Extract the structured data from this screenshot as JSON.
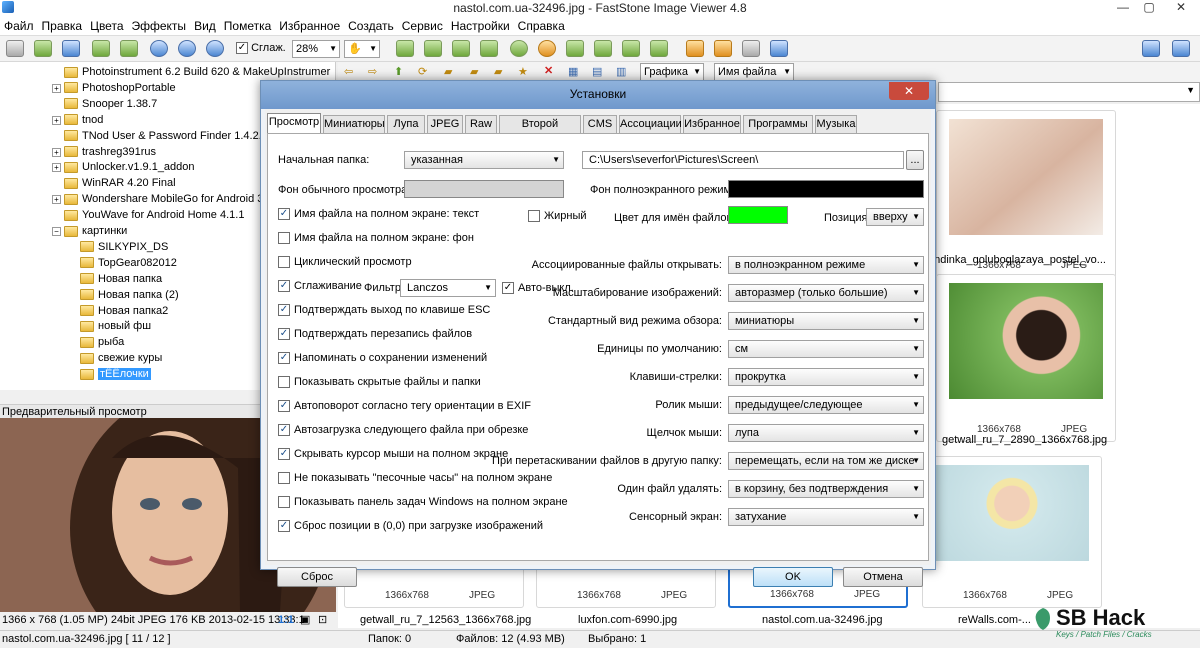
{
  "window": {
    "title": "nastol.com.ua-32496.jpg  -  FastStone Image Viewer 4.8"
  },
  "menu": [
    "Файл",
    "Правка",
    "Цвета",
    "Эффекты",
    "Вид",
    "Пометка",
    "Избранное",
    "Создать",
    "Сервис",
    "Настройки",
    "Справка"
  ],
  "toolbar": {
    "smooth_label": "Сглаж.",
    "zoom": "28%"
  },
  "tree": {
    "items": [
      {
        "label": "Photoinstrument 6.2 Build 620 & MakeUpInstrumer",
        "depth": 1,
        "exp": ""
      },
      {
        "label": "PhotoshopPortable",
        "depth": 1,
        "exp": "+"
      },
      {
        "label": "Snooper 1.38.7",
        "depth": 1,
        "exp": ""
      },
      {
        "label": "tnod",
        "depth": 1,
        "exp": "+"
      },
      {
        "label": "TNod User & Password Finder 1.4.2.1",
        "depth": 1,
        "exp": ""
      },
      {
        "label": "trashreg391rus",
        "depth": 1,
        "exp": "+"
      },
      {
        "label": "Unlocker.v1.9.1_addon",
        "depth": 1,
        "exp": "+"
      },
      {
        "label": "WinRAR 4.20 Final",
        "depth": 1,
        "exp": ""
      },
      {
        "label": "Wondershare MobileGo for Android 3",
        "depth": 1,
        "exp": "+"
      },
      {
        "label": "YouWave for Android Home 4.1.1",
        "depth": 1,
        "exp": ""
      },
      {
        "label": "картинки",
        "depth": 1,
        "exp": "-"
      },
      {
        "label": "SILKYPIX_DS",
        "depth": 2,
        "exp": ""
      },
      {
        "label": "TopGear082012",
        "depth": 2,
        "exp": ""
      },
      {
        "label": "Новая папка",
        "depth": 2,
        "exp": ""
      },
      {
        "label": "Новая папка (2)",
        "depth": 2,
        "exp": ""
      },
      {
        "label": "Новая папка2",
        "depth": 2,
        "exp": ""
      },
      {
        "label": "новый фш",
        "depth": 2,
        "exp": ""
      },
      {
        "label": "рыба",
        "depth": 2,
        "exp": ""
      },
      {
        "label": "свежие куры",
        "depth": 2,
        "exp": ""
      },
      {
        "label": "тЁЁлочки",
        "depth": 2,
        "exp": "",
        "selected": true
      }
    ]
  },
  "preview": {
    "label": "Предварительный просмотр",
    "info": "1366 x 768 (1.05 MP)  24bit  JPEG   176 KB   2013-02-15 13:33:1",
    "zoom": "1:1"
  },
  "thumbbar": {
    "sort_kind": "Графика",
    "sort_by": "Имя файла"
  },
  "thumbs": [
    {
      "dim": "1366x768",
      "fmt": "JPEG",
      "name": "endinka_goluboglazaya_postel_vo...",
      "color": "#e9d7c9"
    },
    {
      "dim": "1366x768",
      "fmt": "JPEG",
      "name": "getwall_ru_7_2890_1366x768.jpg",
      "color": "#6aa34d"
    },
    {
      "dim": "1366x768",
      "fmt": "JPEG",
      "name": "getwall_ru_7_12563_1366x768.jpg",
      "color": "#b4a493"
    },
    {
      "dim": "1366x768",
      "fmt": "JPEG",
      "name": "luxfon.com-6990.jpg",
      "color": "#c9ab95"
    },
    {
      "dim": "1366x768",
      "fmt": "JPEG",
      "name": "nastol.com.ua-32496.jpg",
      "color": "#a27460"
    },
    {
      "dim": "1366x768",
      "fmt": "JPEG",
      "name": "reWalls.com-...",
      "color": "#cfe6ea"
    }
  ],
  "statusbar": {
    "file": "nastol.com.ua-32496.jpg [ 11 / 12 ]",
    "folders": "Папок: 0",
    "files": "Файлов: 12 (4.93 MB)",
    "selected": "Выбрано: 1"
  },
  "dialog": {
    "title": "Установки",
    "close": "✕",
    "tabs": [
      "Просмотр",
      "Миниатюры",
      "Лупа",
      "JPEG",
      "Raw",
      "Второй монитор",
      "CMS",
      "Ассоциации",
      "Избранное",
      "Программы",
      "Музыка"
    ],
    "start_folder_label": "Начальная папка:",
    "start_folder_value": "указанная",
    "start_folder_path": "C:\\Users\\severfor\\Pictures\\Screen\\",
    "browse": "...",
    "bg_normal_label": "Фон обычного просмотра:",
    "bg_normal_color": "#d4d4d4",
    "bg_full_label": "Фон полноэкранного режима:",
    "bg_full_color": "#000000",
    "fn_color_label": "Цвет для имён файлов:",
    "fn_color": "#00ff00",
    "position_label": "Позиция:",
    "position_value": "вверху",
    "bold_label": "Жирный",
    "filter_label": "Фильтр:",
    "filter_value": "Lanczos",
    "auto_off_label": "Авто-выкл.",
    "checks": [
      {
        "label": "Имя файла на полном экране: текст",
        "checked": true
      },
      {
        "label": "Имя файла на полном экране: фон",
        "checked": false
      },
      {
        "label": "Циклический просмотр",
        "checked": false
      },
      {
        "label": "Сглаживание",
        "checked": true
      },
      {
        "label": "Подтверждать выход по клавише ESC",
        "checked": true
      },
      {
        "label": "Подтверждать перезапись файлов",
        "checked": true
      },
      {
        "label": "Напоминать о сохранении изменений",
        "checked": true
      },
      {
        "label": "Показывать скрытые файлы и папки",
        "checked": false
      },
      {
        "label": "Автоповорот согласно тегу ориентации в EXIF",
        "checked": true
      },
      {
        "label": "Автозагрузка следующего файла при обрезке",
        "checked": true
      },
      {
        "label": "Скрывать курсор мыши на полном экране",
        "checked": true
      },
      {
        "label": "Не показывать \"песочные часы\" на полном экране",
        "checked": false
      },
      {
        "label": "Показывать панель задач Windows на полном экране",
        "checked": false
      },
      {
        "label": "Сброс позиции в (0,0) при загрузке изображений",
        "checked": true
      }
    ],
    "settings": [
      {
        "label": "Ассоциированные файлы открывать:",
        "value": "в полноэкранном режиме"
      },
      {
        "label": "Масштабирование изображений:",
        "value": "авторазмер (только большие)"
      },
      {
        "label": "Стандартный вид режима обзора:",
        "value": "миниатюры"
      },
      {
        "label": "Единицы по умолчанию:",
        "value": "см"
      },
      {
        "label": "Клавиши-стрелки:",
        "value": "прокрутка"
      },
      {
        "label": "Ролик мыши:",
        "value": "предыдущее/следующее"
      },
      {
        "label": "Щелчок мыши:",
        "value": "лупа"
      },
      {
        "label": "При перетаскивании файлов в другую папку:",
        "value": "перемещать, если на том же диске"
      },
      {
        "label": "Один файл удалять:",
        "value": "в корзину, без подтверждения"
      },
      {
        "label": "Сенсорный экран:",
        "value": "затухание"
      }
    ],
    "reset": "Сброс",
    "ok": "OK",
    "cancel": "Отмена"
  },
  "watermark": {
    "text": "SB Hack",
    "sub": "Keys / Patch Files / Cracks"
  }
}
